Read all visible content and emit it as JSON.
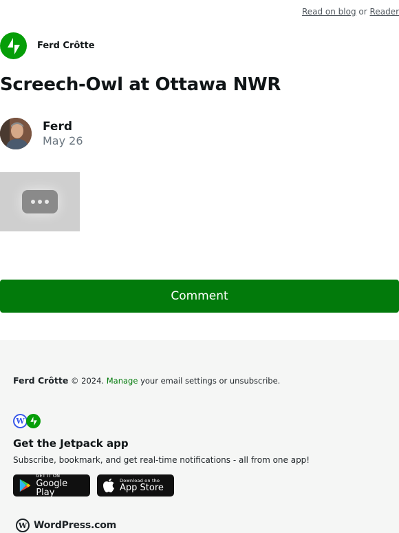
{
  "topbar": {
    "read_on_blog": "Read on blog",
    "or": "or",
    "reader": "Reader"
  },
  "blog": {
    "name": "Ferd Crôtte",
    "logo_icon": "jetpack-bolt-icon",
    "brand_color": "#069e08"
  },
  "post": {
    "title": "Screech-Owl at Ottawa NWR",
    "author": "Ferd",
    "date": "May 26",
    "media_icon": "video-ellipsis-icon"
  },
  "comment_button": {
    "label": "Comment",
    "color": "#027a0b"
  },
  "footer": {
    "owner": "Ferd Crôtte",
    "copyright": "© 2024.",
    "manage_link": "Manage",
    "manage_rest": "your email settings or unsubscribe.",
    "app_title": "Get the Jetpack app",
    "app_subtitle": "Subscribe, bookmark, and get real-time notifications - all from one app!",
    "google_play": {
      "small": "GET IT ON",
      "big": "Google Play"
    },
    "app_store": {
      "small": "Download on the",
      "big": "App Store"
    },
    "wpcom_label": "WordPress.com",
    "background": "#f5f6f5"
  }
}
